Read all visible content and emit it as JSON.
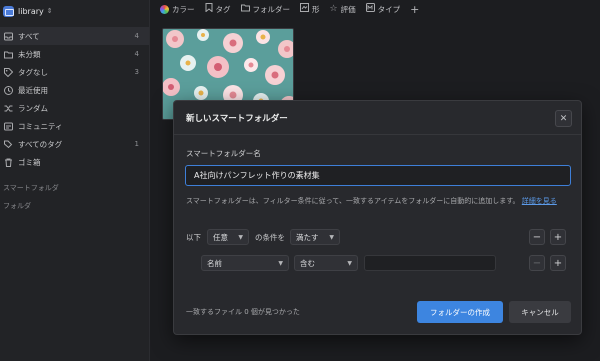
{
  "sidebar": {
    "library_title": "library",
    "items": [
      {
        "label": "すべて",
        "count": "4",
        "icon": "inbox-icon"
      },
      {
        "label": "未分類",
        "count": "4",
        "icon": "folder-icon"
      },
      {
        "label": "タグなし",
        "count": "3",
        "icon": "tag-icon"
      },
      {
        "label": "最近使用",
        "count": "",
        "icon": "clock-icon"
      },
      {
        "label": "ランダム",
        "count": "",
        "icon": "shuffle-icon"
      },
      {
        "label": "コミュニティ",
        "count": "",
        "icon": "community-icon"
      },
      {
        "label": "すべてのタグ",
        "count": "1",
        "icon": "tags-icon"
      },
      {
        "label": "ゴミ箱",
        "count": "",
        "icon": "trash-icon"
      }
    ],
    "sections": [
      "スマートフォルダ",
      "フォルダ"
    ]
  },
  "toolbar": {
    "color": "カラー",
    "tag": "タグ",
    "folder": "フォルダー",
    "shape": "形",
    "rating": "評価",
    "type": "タイプ",
    "add": "+"
  },
  "modal": {
    "title": "新しいスマートフォルダー",
    "name_label": "スマートフォルダー名",
    "name_value": "A社向けパンフレット作りの素材集",
    "description": "スマートフォルダーは、フィルター条件に従って、一致するアイテムをフォルダーに自動的に追加します。",
    "details_link": "詳細を見る",
    "condition_prefix": "以下",
    "match_mode": "任意",
    "condition_middle": "の条件を",
    "match_action": "満たす",
    "field": "名前",
    "operator": "含む",
    "value": "",
    "minus": "−",
    "plus": "+",
    "result_text": "一致するファイル 0 個が見つかった",
    "create_button": "フォルダーの作成",
    "cancel_button": "キャンセル"
  },
  "colors": {
    "accent": "#3d85e0",
    "background": "#1c1d20",
    "sidebar": "#222326",
    "modal": "#28292d"
  }
}
